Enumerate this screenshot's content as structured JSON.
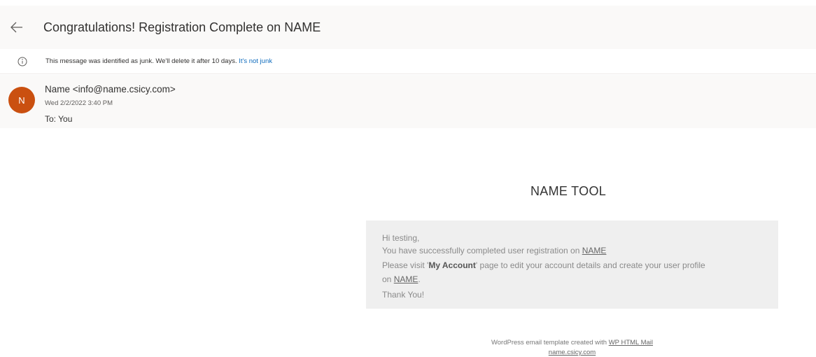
{
  "header": {
    "subject": "Congratulations! Registration Complete on NAME",
    "back_icon": "arrow-left-icon"
  },
  "junk_notice": {
    "icon": "info-icon",
    "text": "This message was identified as junk. We'll delete it after 10 days.",
    "link": "It's not junk"
  },
  "sender": {
    "initial": "N",
    "avatar_color": "#ca5010",
    "line": "Name <info@name.csicy.com>",
    "date": "Wed 2/2/2022 3:40 PM",
    "to": "To: You"
  },
  "email_body": {
    "brand_title": "NAME TOOL",
    "greeting": "Hi testing,",
    "line1_text": "You have successfully completed user registration on",
    "line1_link": "NAME",
    "line2_before": "Please visit '",
    "line2_bold": "My Account",
    "line2_after": "' page to edit your account details and create your user profile",
    "line3_text": "on",
    "line3_link": "NAME",
    "line3_end": ".",
    "thanks": "Thank You!",
    "footer_text": "WordPress email template created with",
    "footer_link": "WP HTML Mail",
    "footer_domain": "name.csicy.com"
  }
}
